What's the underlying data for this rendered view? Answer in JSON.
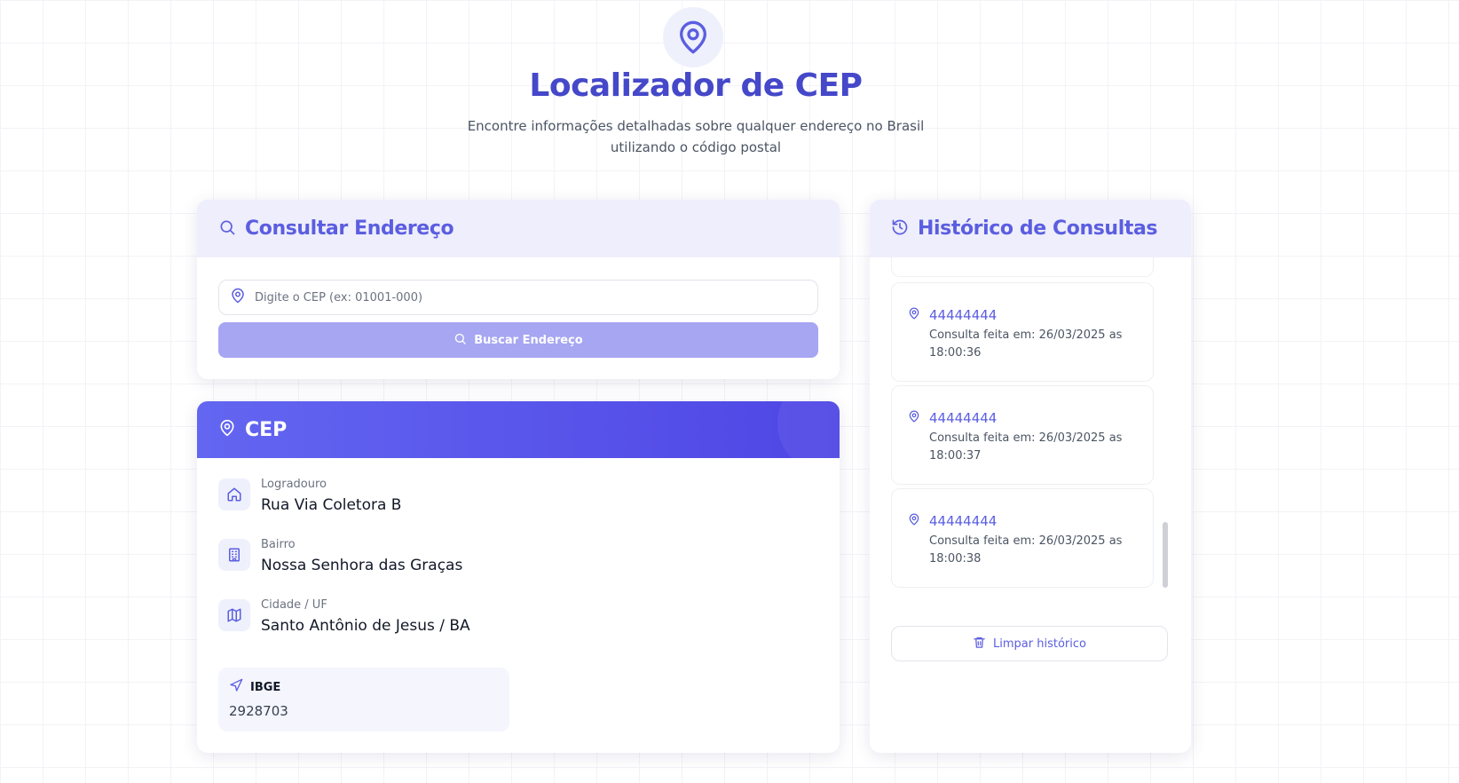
{
  "header": {
    "title": "Localizador de CEP",
    "subtitle_line1": "Encontre informações detalhadas sobre qualquer endereço no Brasil",
    "subtitle_line2": "utilizando o código postal",
    "icon": "map-pin-icon"
  },
  "search": {
    "title": "Consultar Endereço",
    "input_placeholder": "Digite o CEP (ex: 01001-000)",
    "input_value": "",
    "button_label": "Buscar Endereço"
  },
  "result": {
    "title": "CEP",
    "fields": [
      {
        "label": "Logradouro",
        "value": "Rua Via Coletora B",
        "icon": "home-icon"
      },
      {
        "label": "Bairro",
        "value": "Nossa Senhora das Graças",
        "icon": "building-icon"
      },
      {
        "label": "Cidade / UF",
        "value": "Santo Antônio de Jesus / BA",
        "icon": "map-icon"
      }
    ],
    "ibge_label": "IBGE",
    "ibge_value": "2928703"
  },
  "history": {
    "title": "Histórico de Consultas",
    "items": [
      {
        "cep": "44444444",
        "time": "Consulta feita em: 26/03/2025 as 18:00:36"
      },
      {
        "cep": "44444444",
        "time": "Consulta feita em: 26/03/2025 as 18:00:37"
      },
      {
        "cep": "44444444",
        "time": "Consulta feita em: 26/03/2025 as 18:00:38"
      }
    ],
    "clear_label": "Limpar histórico"
  },
  "colors": {
    "accent": "#4548c9",
    "primary": "#5b5ee0",
    "button_disabled": "#a6a6f2"
  }
}
